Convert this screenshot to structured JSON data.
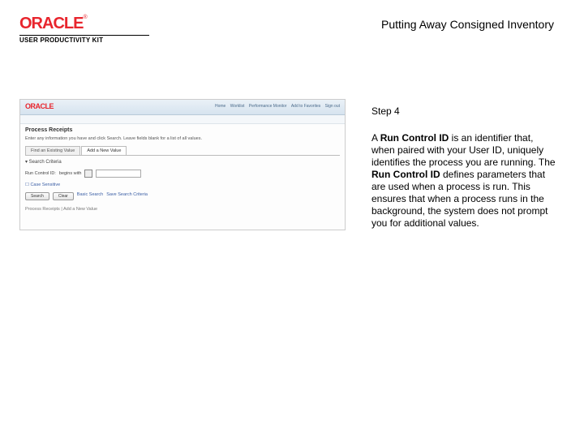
{
  "logo": {
    "brand": "ORACLE",
    "tm": "®",
    "subline": "USER PRODUCTIVITY KIT"
  },
  "title": "Putting Away Consigned Inventory",
  "step": "Step 4",
  "body": {
    "p1a": "A ",
    "p1b": "Run Control ID",
    "p1c": " is an identifier that, when paired with your User ID, uniquely identifies the process you are running. The ",
    "p1d": "Run Control ID",
    "p1e": " defines parameters that are used when a process is run. This ensures that when a process runs in the background, the system does not prompt you for additional values."
  },
  "ss": {
    "brand": "ORACLE",
    "nav": {
      "a": "Home",
      "b": "Worklist",
      "c": "Performance Monitor",
      "d": "Add to Favorites",
      "e": "Sign out"
    },
    "heading": "Process Receipts",
    "instr": "Enter any information you have and click Search. Leave fields blank for a list of all values.",
    "tab1": "Find an Existing Value",
    "tab2": "Add a New Value",
    "section": "▾ Search Criteria",
    "field_label": "Run Control ID:",
    "op": "begins with",
    "btn_search": "Search",
    "btn_clear": "Clear",
    "link_basic": "Basic Search",
    "link_save": "Save Search Criteria",
    "save_link": "Find an Existing Value | Add a New Value",
    "footer": "Process Receipts  |  Add a New Value"
  }
}
